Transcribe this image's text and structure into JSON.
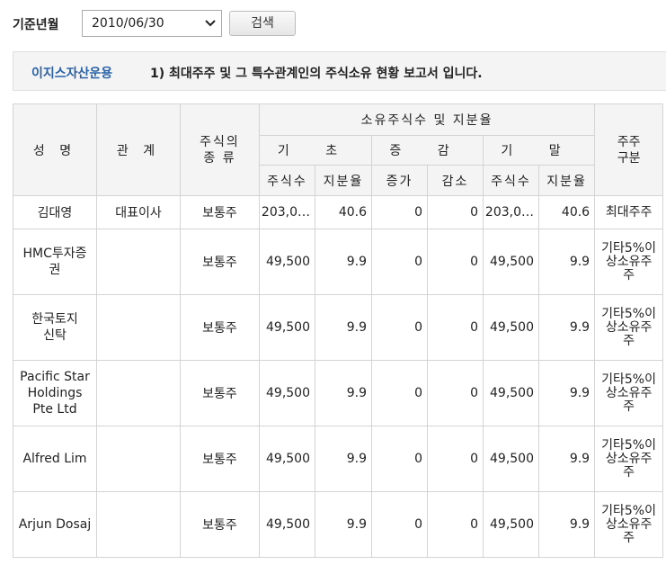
{
  "toolbar": {
    "label": "기준년월",
    "selected_date": "2010/06/30",
    "search_label": "검색"
  },
  "notice": {
    "company": "이지스자산운용",
    "message": "1) 최대주주 및 그 특수관계인의 주식소유 현황 보고서 입니다."
  },
  "table": {
    "headers": {
      "name": "성 명",
      "relation": "관 계",
      "stock_type": "주식의 종 류",
      "holdings": "소유주식수 및 지분율",
      "begin": "기 초",
      "change": "증 감",
      "end": "기 말",
      "category": "주주 구분",
      "begin_shares": "주식수",
      "begin_ratio": "지분율",
      "increase": "증가",
      "decrease": "감소",
      "end_shares": "주식수",
      "end_ratio": "지분율"
    },
    "rows": [
      {
        "name": "김대영",
        "relation": "대표이사",
        "stock_type": "보통주",
        "begin_shares": "203,0…",
        "begin_ratio": "40.6",
        "increase": "0",
        "decrease": "0",
        "end_shares": "203,0…",
        "end_ratio": "40.6",
        "category": "최대주주"
      },
      {
        "name": "HMC투자증권",
        "relation": "",
        "stock_type": "보통주",
        "begin_shares": "49,500",
        "begin_ratio": "9.9",
        "increase": "0",
        "decrease": "0",
        "end_shares": "49,500",
        "end_ratio": "9.9",
        "category": "기타5%이상소유주주"
      },
      {
        "name": "한국토지신탁",
        "relation": "",
        "stock_type": "보통주",
        "begin_shares": "49,500",
        "begin_ratio": "9.9",
        "increase": "0",
        "decrease": "0",
        "end_shares": "49,500",
        "end_ratio": "9.9",
        "category": "기타5%이상소유주주"
      },
      {
        "name": "Pacific Star Holdings Pte Ltd",
        "relation": "",
        "stock_type": "보통주",
        "begin_shares": "49,500",
        "begin_ratio": "9.9",
        "increase": "0",
        "decrease": "0",
        "end_shares": "49,500",
        "end_ratio": "9.9",
        "category": "기타5%이상소유주주"
      },
      {
        "name": "Alfred Lim",
        "relation": "",
        "stock_type": "보통주",
        "begin_shares": "49,500",
        "begin_ratio": "9.9",
        "increase": "0",
        "decrease": "0",
        "end_shares": "49,500",
        "end_ratio": "9.9",
        "category": "기타5%이상소유주주"
      },
      {
        "name": "Arjun Dosaj",
        "relation": "",
        "stock_type": "보통주",
        "begin_shares": "49,500",
        "begin_ratio": "9.9",
        "increase": "0",
        "decrease": "0",
        "end_shares": "49,500",
        "end_ratio": "9.9",
        "category": "기타5%이상소유주주"
      }
    ]
  }
}
